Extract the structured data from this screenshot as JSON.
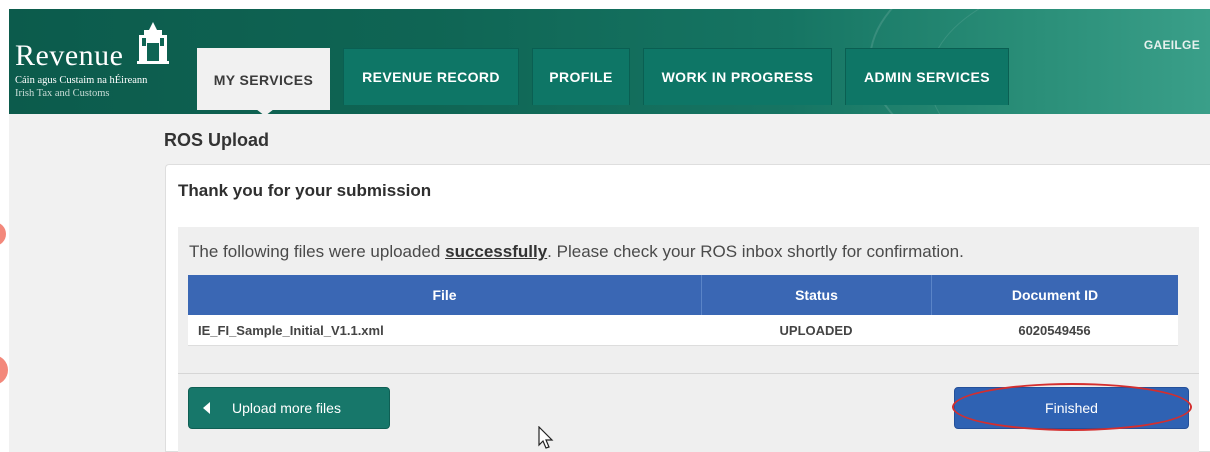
{
  "header": {
    "brand": "Revenue",
    "subtitle_irish": "Cáin agus Custaim na hÉireann",
    "subtitle_english": "Irish Tax and Customs",
    "language_link": "GAEILGE",
    "tabs": [
      {
        "label": "MY SERVICES",
        "active": true
      },
      {
        "label": "REVENUE RECORD",
        "active": false
      },
      {
        "label": "PROFILE",
        "active": false
      },
      {
        "label": "WORK IN PROGRESS",
        "active": false
      },
      {
        "label": "ADMIN SERVICES",
        "active": false
      }
    ]
  },
  "page": {
    "title": "ROS Upload",
    "panel_title": "Thank you for your submission",
    "message_before": "The following files were uploaded ",
    "message_emphasis": "successfully",
    "message_after": ". Please check your ROS inbox shortly for confirmation."
  },
  "table": {
    "columns": [
      "File",
      "Status",
      "Document ID"
    ],
    "rows": [
      {
        "file": "IE_FI_Sample_Initial_V1.1.xml",
        "status": "UPLOADED",
        "document_id": "6020549456"
      }
    ]
  },
  "actions": {
    "upload_more_label": "Upload more files",
    "finished_label": "Finished"
  },
  "colors": {
    "header_green": "#0f6554",
    "tab_green": "#0e7666",
    "table_header_blue": "#3a67b4",
    "finish_button_blue": "#2f62b3",
    "back_button_teal": "#17776a",
    "highlight_red": "#d42e2e"
  }
}
